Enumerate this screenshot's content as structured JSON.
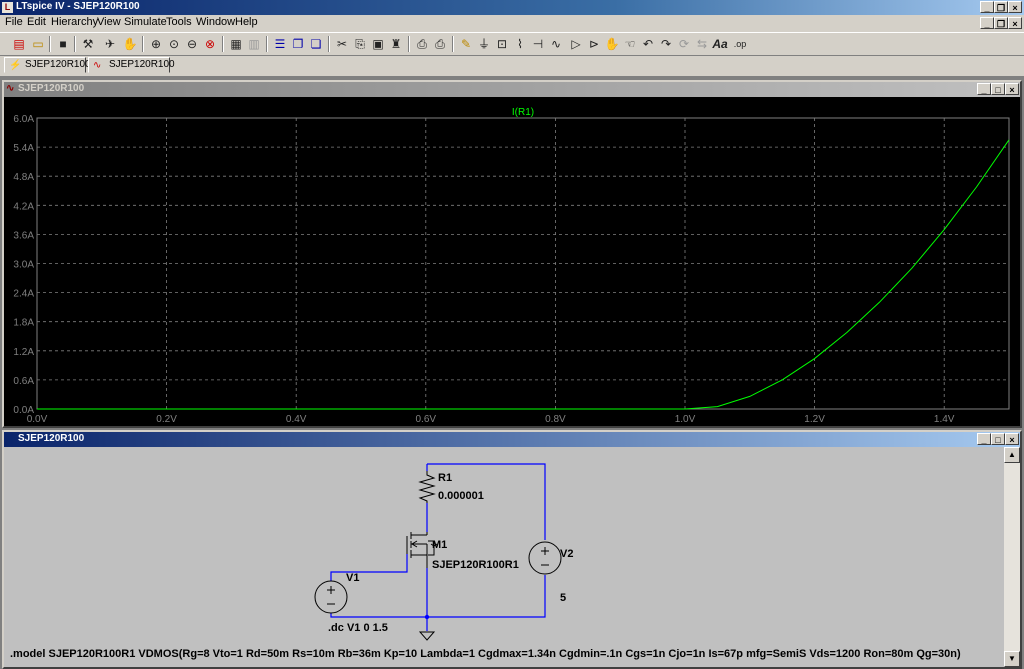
{
  "window": {
    "title": "LTspice IV - SJEP120R100"
  },
  "menu": [
    "File",
    "Edit",
    "Hierarchy",
    "View",
    "Simulate",
    "Tools",
    "Window",
    "Help"
  ],
  "toolbar_icons": [
    "new-schematic",
    "open-file",
    "save",
    "control-panel",
    "run",
    "halt",
    "zoom-in",
    "pan",
    "zoom-out",
    "zoom-fit",
    "cancel-zoom",
    "autorange",
    "waveform-settings",
    "tile-horizontal",
    "tile-vertical",
    "cascade",
    "cut",
    "copy",
    "paste",
    "find",
    "print-setup",
    "print",
    "draw-wire",
    "ground",
    "label-net",
    "resistor",
    "capacitor",
    "inductor",
    "diode",
    "component",
    "move",
    "drag",
    "undo",
    "redo",
    "rotate",
    "mirror",
    "text",
    "spice-directive"
  ],
  "tabs": [
    {
      "label": "SJEP120R100",
      "icon": "schematic-icon"
    },
    {
      "label": "SJEP120R100",
      "icon": "waveform-icon"
    }
  ],
  "plot_window": {
    "title": "SJEP120R100"
  },
  "schematic_window": {
    "title": "SJEP120R100"
  },
  "chart_data": {
    "type": "line",
    "series": [
      {
        "name": "I(R1)",
        "color": "#00ff00",
        "x": [
          0.0,
          0.2,
          0.4,
          0.6,
          0.8,
          1.0,
          1.05,
          1.1,
          1.15,
          1.2,
          1.25,
          1.3,
          1.35,
          1.4,
          1.45,
          1.5
        ],
        "y": [
          0,
          0,
          0,
          0,
          0,
          0,
          0.05,
          0.26,
          0.6,
          1.04,
          1.58,
          2.2,
          2.9,
          3.7,
          4.58,
          5.55
        ]
      }
    ],
    "xlim": [
      0,
      1.5
    ],
    "ylim": [
      0,
      6.0
    ],
    "xticks": [
      "0.0V",
      "0.2V",
      "0.4V",
      "0.6V",
      "0.8V",
      "1.0V",
      "1.2V",
      "1.4V"
    ],
    "yticks": [
      "0.0A",
      "0.6A",
      "1.2A",
      "1.8A",
      "2.4A",
      "3.0A",
      "3.6A",
      "4.2A",
      "4.8A",
      "5.4A",
      "6.0A"
    ],
    "grid": true
  },
  "schematic": {
    "r1_name": "R1",
    "r1_value": "0.000001",
    "m1_name": "M1",
    "m1_model": "SJEP120R100R1",
    "v1_name": "V1",
    "v2_name": "V2",
    "v2_value": "5",
    "dc_directive": ".dc V1 0 1.5",
    "model_directive": ".model SJEP120R100R1 VDMOS(Rg=8 Vto=1 Rd=50m Rs=10m Rb=36m Kp=10 Lambda=1 Cgdmax=1.34n Cgdmin=.1n Cgs=1n Cjo=1n Is=67p mfg=SemiS Vds=1200 Ron=80m Qg=30n)"
  }
}
